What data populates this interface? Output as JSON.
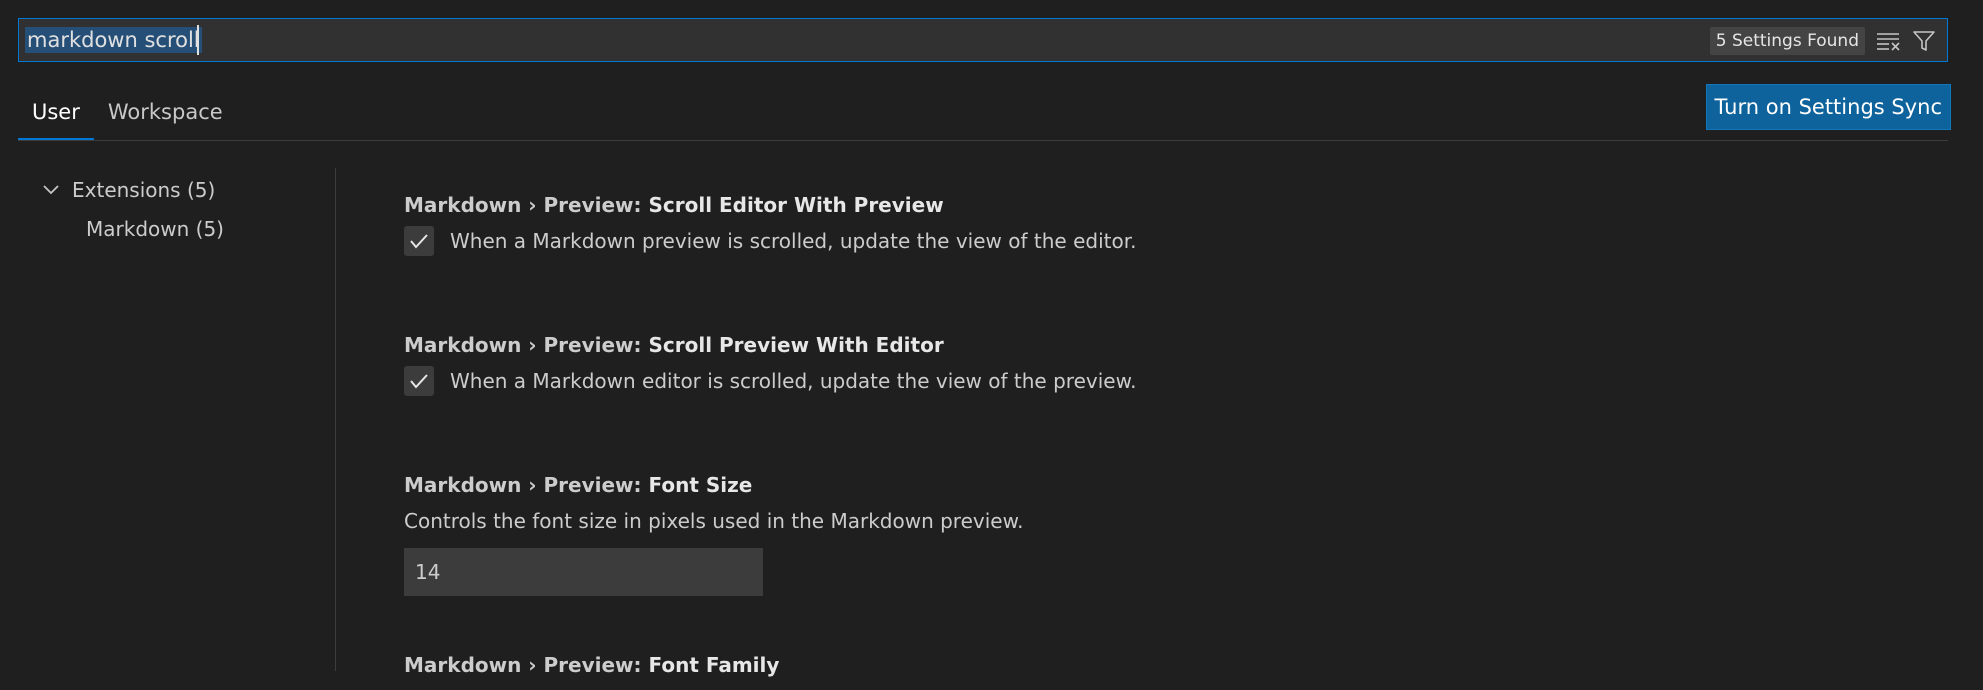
{
  "search": {
    "value": "markdown scroll",
    "results_badge": "5 Settings Found"
  },
  "icons": {
    "clear_filter": "clear-filter-icon",
    "filter": "filter-icon",
    "chevron": "chevron-down-icon",
    "check": "check-icon"
  },
  "colors": {
    "accent": "#0078d4",
    "button_bg": "#0e639c",
    "background": "#1f1f1f",
    "selection": "#264f78"
  },
  "tabs": [
    {
      "label": "User",
      "active": true
    },
    {
      "label": "Workspace",
      "active": false
    }
  ],
  "sync_button": {
    "label": "Turn on Settings Sync"
  },
  "toc": {
    "group": {
      "label": "Extensions (5)",
      "expanded": true
    },
    "child": {
      "label": "Markdown (5)"
    }
  },
  "settings": [
    {
      "category": "Markdown › Preview: ",
      "name": "Scroll Editor With Preview",
      "description": "When a Markdown preview is scrolled, update the view of the editor.",
      "type": "checkbox",
      "checked": true
    },
    {
      "category": "Markdown › Preview: ",
      "name": "Scroll Preview With Editor",
      "description": "When a Markdown editor is scrolled, update the view of the preview.",
      "type": "checkbox",
      "checked": true
    },
    {
      "category": "Markdown › Preview: ",
      "name": "Font Size",
      "description": "Controls the font size in pixels used in the Markdown preview.",
      "type": "number",
      "value": "14"
    },
    {
      "category": "Markdown › Preview: ",
      "name": "Font Family",
      "partially_visible": true
    }
  ]
}
